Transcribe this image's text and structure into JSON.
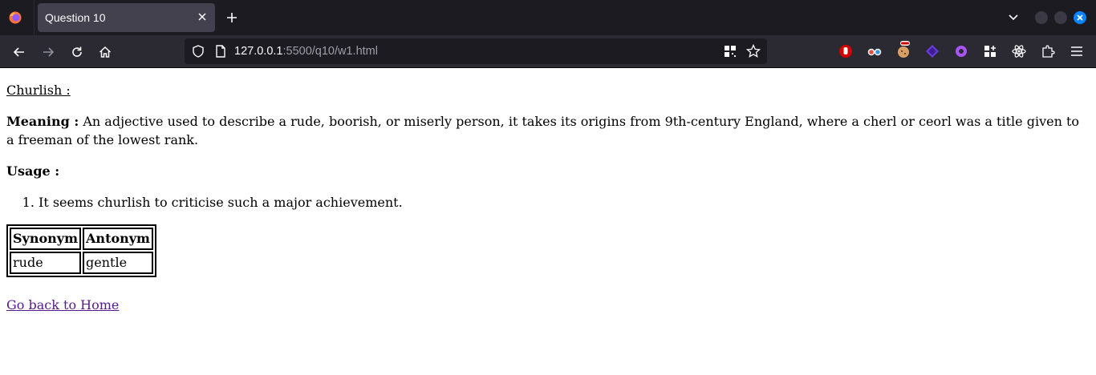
{
  "browser": {
    "tab_title": "Question 10",
    "url_host": "127.0.0.1",
    "url_rest": ":5500/q10/w1.html"
  },
  "content": {
    "word": "Churlish :",
    "meaning_label": "Meaning :",
    "meaning_text": " An adjective used to describe a rude, boorish, or miserly person, it takes its origins from 9th-century England, where a cherl or ceorl was a title given to a freeman of the lowest rank.",
    "usage_label": "Usage :",
    "usage_items": [
      "It seems churlish to criticise such a major achievement."
    ],
    "table": {
      "headers": [
        "Synonym",
        "Antonym"
      ],
      "rows": [
        [
          "rude",
          "gentle"
        ]
      ]
    },
    "home_link": "Go back to Home"
  }
}
